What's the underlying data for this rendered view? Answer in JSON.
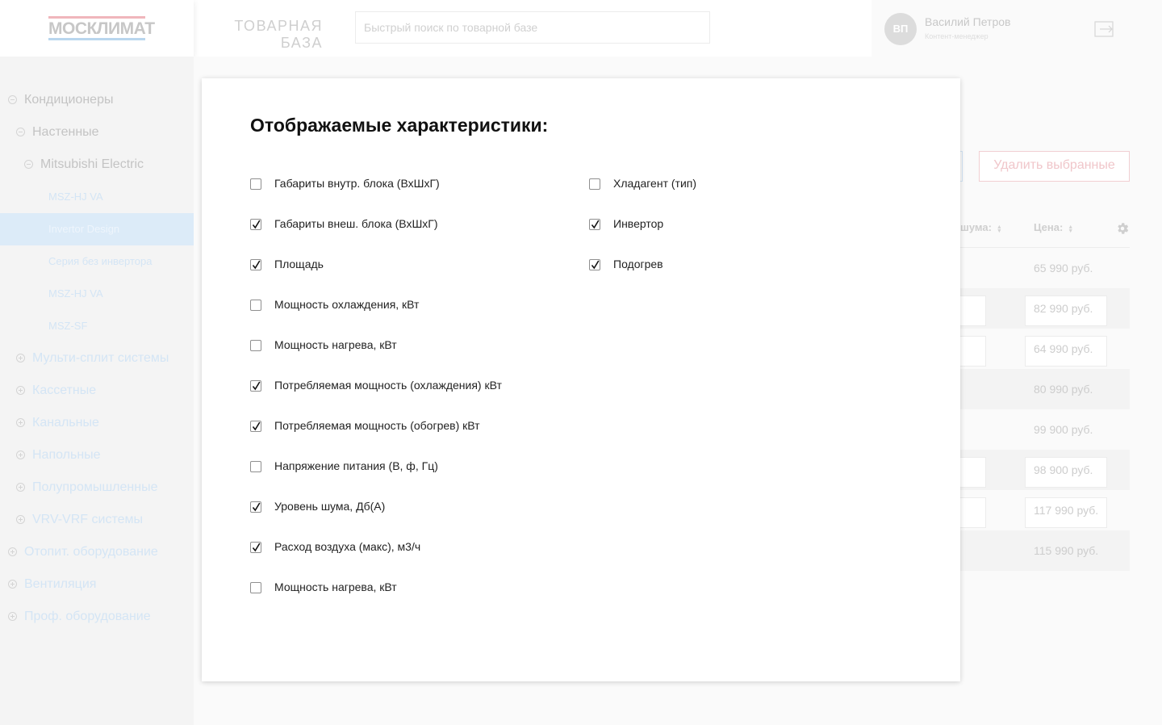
{
  "header": {
    "logo_text": "МОСКЛИМАТ",
    "section_title": "ТОВАРНАЯ\nБАЗА",
    "search_placeholder": "Быстрый поиск по товарной базе",
    "user": {
      "initials": "ВП",
      "name": "Василий Петров",
      "role": "Контент-менеджер"
    },
    "logout_icon": "logout-icon"
  },
  "sidebar": {
    "items": [
      {
        "label": "Кондиционеры",
        "toggle": "minus"
      },
      {
        "label": "Настенные",
        "toggle": "minus"
      },
      {
        "label": "Mitsubishi Electric",
        "toggle": "minus"
      },
      {
        "label": "MSZ-HJ VA"
      },
      {
        "label": "Invertor Design",
        "active": true
      },
      {
        "label": "Серия без инвертора"
      },
      {
        "label": "MSZ-HJ VA"
      },
      {
        "label": "MSZ-SF"
      },
      {
        "label": "Мульти-сплит системы",
        "toggle": "plus"
      },
      {
        "label": "Кассетные",
        "toggle": "plus"
      },
      {
        "label": "Канальные",
        "toggle": "plus"
      },
      {
        "label": "Напольные",
        "toggle": "plus"
      },
      {
        "label": "Полупромышленные",
        "toggle": "plus"
      },
      {
        "label": "VRV-VRF системы",
        "toggle": "plus"
      },
      {
        "label": "Отопит. оборудование",
        "toggle": "plus"
      },
      {
        "label": "Вентиляция",
        "toggle": "plus"
      },
      {
        "label": "Проф. оборудование",
        "toggle": "plus"
      }
    ]
  },
  "background": {
    "delete_button": "Удалить выбранные",
    "columns": {
      "noise": "шума:",
      "price": "Цена:"
    },
    "prices": [
      "65 990 руб.",
      "82 990 руб.",
      "64 990 руб.",
      "80 990 руб.",
      "99 900 руб.",
      "98 900 руб.",
      "117 990 руб.",
      "115 990 руб."
    ]
  },
  "modal": {
    "title": "Отображаемые характеристики:",
    "left_options": [
      {
        "label": "Габариты внутр. блока (ВхШхГ)",
        "checked": false
      },
      {
        "label": "Габариты внеш. блока (ВхШхГ)",
        "checked": true
      },
      {
        "label": "Площадь",
        "checked": true
      },
      {
        "label": "Мощность охлаждения, кВт",
        "checked": false
      },
      {
        "label": "Мощность нагрева, кВт",
        "checked": false
      },
      {
        "label": "Потребляемая мощность (охлаждения) кВт",
        "checked": true
      },
      {
        "label": "Потребляемая мощность (обогрев) кВт",
        "checked": true
      },
      {
        "label": "Напряжение питания (В, ф, Гц)",
        "checked": false
      },
      {
        "label": "Уровень шума, Дб(А)",
        "checked": true
      },
      {
        "label": "Расход воздуха (макс), м3/ч",
        "checked": true
      },
      {
        "label": "Мощность нагрева, кВт",
        "checked": false
      }
    ],
    "right_options": [
      {
        "label": "Хладагент (тип)",
        "checked": false
      },
      {
        "label": "Инвертор",
        "checked": true
      },
      {
        "label": "Подогрев",
        "checked": true
      }
    ]
  },
  "colors": {
    "accent_blue": "#dcebf8",
    "accent_red": "#f0c6ca",
    "modal_bg": "#ffffff"
  }
}
